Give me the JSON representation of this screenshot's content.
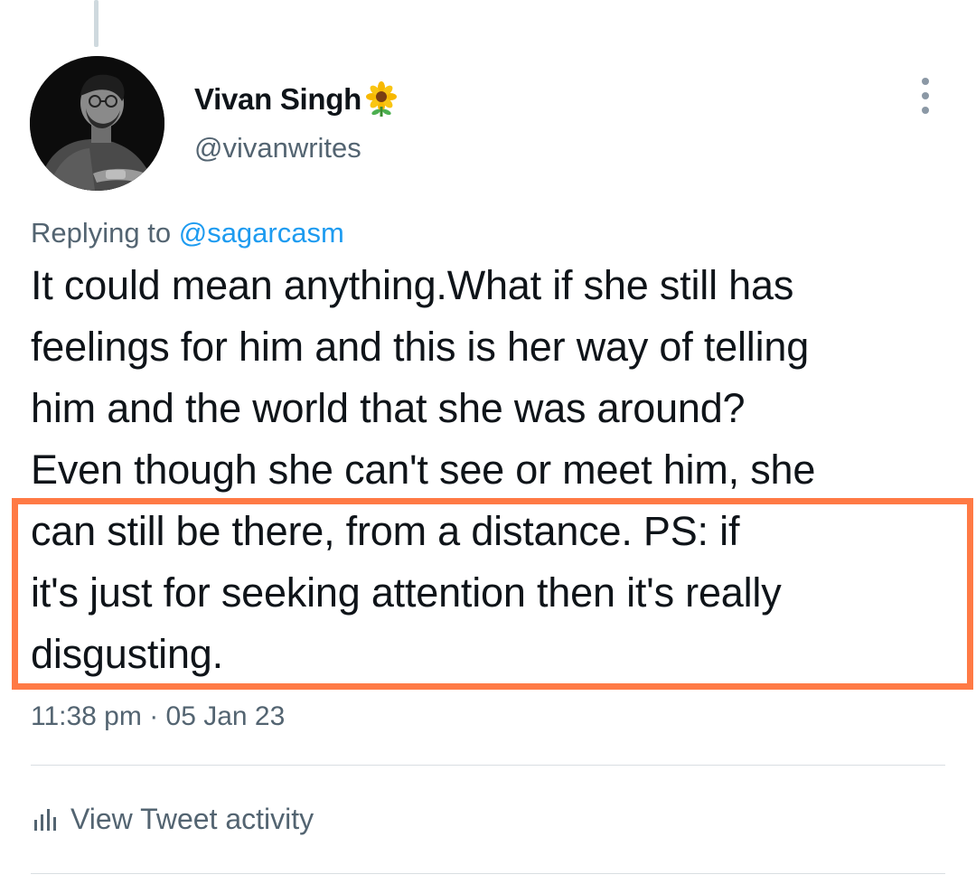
{
  "author": {
    "display_name": "Vivan Singh",
    "name_emoji_icon": "sunflower-icon",
    "handle": "@vivanwrites"
  },
  "reply": {
    "prefix": "Replying to",
    "mention": "@sagarcasm"
  },
  "tweet": {
    "lines": [
      "It could mean anything.What if she still has",
      "feelings for him and this is her way of telling",
      "him and the world that she was around?",
      "Even though she can't see or meet him, she",
      "can still be there, from a distance. PS: if",
      "it's just for seeking attention then it's really",
      "disgusting."
    ],
    "highlight_color": "#ff7a45"
  },
  "meta": {
    "timestamp": "11:38 pm · 05 Jan 23"
  },
  "actions": {
    "activity_label": "View Tweet activity",
    "activity_icon": "bar-chart-icon",
    "more_icon": "more-vertical-icon"
  },
  "colors": {
    "text_primary": "#0f1419",
    "text_secondary": "#536471",
    "link": "#1d9bf0"
  }
}
